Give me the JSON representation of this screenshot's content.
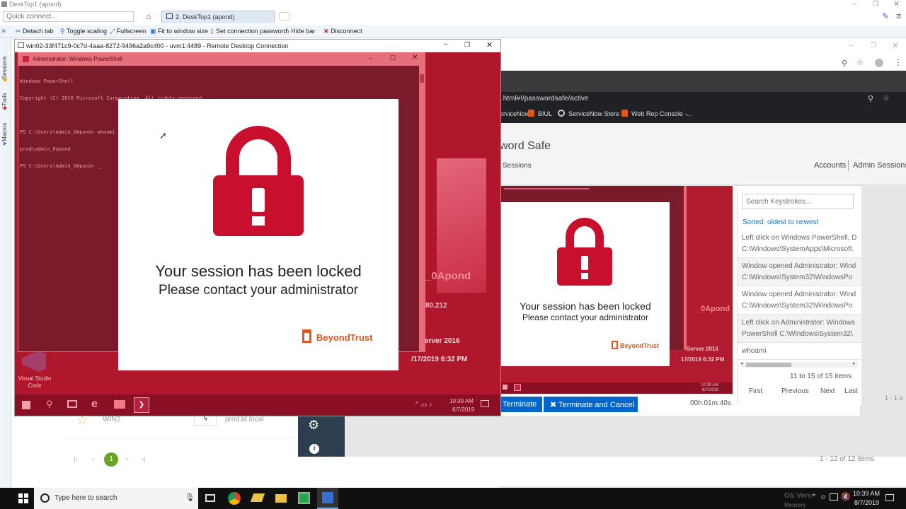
{
  "app": {
    "title": "DeskTop1 (apond)"
  },
  "quick": {
    "placeholder": "Quick connect..."
  },
  "tab": {
    "label": "2. DeskTop1 (apond)"
  },
  "toolbar": {
    "detach": "Detach tab",
    "toggle": "Toggle scaling",
    "fullscreen": "Fullscreen",
    "fit": "Fit to window size",
    "setpw": "Set connection password",
    "hide": "Hide bar",
    "disconnect": "Disconnect"
  },
  "side": {
    "sessions": "Sessions",
    "tools": "Tools",
    "macros": "Macros"
  },
  "rdp": {
    "title": "win02-33f471c9-0c7d-4aaa-8272-9496a2a9c400 - uvm1:4489 - Remote Desktop Connection"
  },
  "ps": {
    "title": "Administrator: Windows PowerShell",
    "lines": [
      "Windows PowerShell",
      "Copyright (C) 2016 Microsoft Corporation. All rights reserved.",
      "",
      "PS C:\\Users\\Admin_0Apond> whoami",
      "prod\\admin_0apond",
      "PS C:\\Users\\Admin_0Apond> _"
    ]
  },
  "locked": {
    "line1": "Your session has been locked",
    "line2": "Please contact your administrator",
    "brand": "BeyondTrust"
  },
  "desktop": {
    "vscode": "Visual Studio Code",
    "bgtext1": "_0Apond",
    "bgtext2": "80.212",
    "bgtext3": "s Server 2016",
    "bgtext4": "/17/2019 6:32 PM",
    "time": "10:39 AM",
    "date": "8/7/2019"
  },
  "browser": {
    "url": ".html#!/passwordsafe/active",
    "bookmarks": [
      "ServiceNow",
      "BIUL",
      "ServiceNow Store",
      "Web Rep Console -..."
    ],
    "page_title": "word Safe",
    "nav_sessions": "Sessions",
    "nav_accounts": "Accounts",
    "nav_admin": "Admin Sessions"
  },
  "keys": {
    "search_placeholder": "Search Keystrokes...",
    "sorted": "Sorted: oldest to newest",
    "items": [
      {
        "l1": "Left click on Windows PowerShell, D",
        "l2": "C:\\Windows\\SystemApps\\Microsoft."
      },
      {
        "l1": "Window opened Administrator: Wind",
        "l2": "C:\\Windows\\System32\\WindowsPo"
      },
      {
        "l1": "Window opened Administrator: Wind",
        "l2": "C:\\Windows\\System32\\WindowsPo"
      },
      {
        "l1": "Left click on Administrator: Windows",
        "l2": "PowerShell C:\\Windows\\System32\\"
      },
      {
        "l1": "whoami",
        "l2": ""
      }
    ],
    "count": "11 to 15 of 15 items",
    "first": "First",
    "prev": "Previous",
    "next": "Next",
    "last": "Last"
  },
  "mini": {
    "bgtext1": "_0Apond",
    "bgtext2": "Server 2016",
    "bgtext3": "17/2019 6:32 PM",
    "time": "10:39 AM",
    "date": "8/7/2019"
  },
  "actions": {
    "terminate": "Terminate",
    "terminate_cancel": "Terminate and Cancel",
    "timer": "00h:01m:40s"
  },
  "back": {
    "row_name": "WIN2",
    "row_domain": "prod.bt.local",
    "page": "1",
    "count": "1 - 12 of 12 items",
    "count2": "1 - 1 o"
  },
  "taskbar": {
    "search": "Type here to search",
    "os": "OS Versi",
    "mem": "Memory",
    "time": "10:39 AM",
    "date": "8/7/2019"
  },
  "colors": {
    "lock_red": "#c8102e",
    "ps_bg": "#7a1a2a",
    "bar_blue": "#0066cc",
    "beyondtrust_orange": "#e2561b"
  }
}
